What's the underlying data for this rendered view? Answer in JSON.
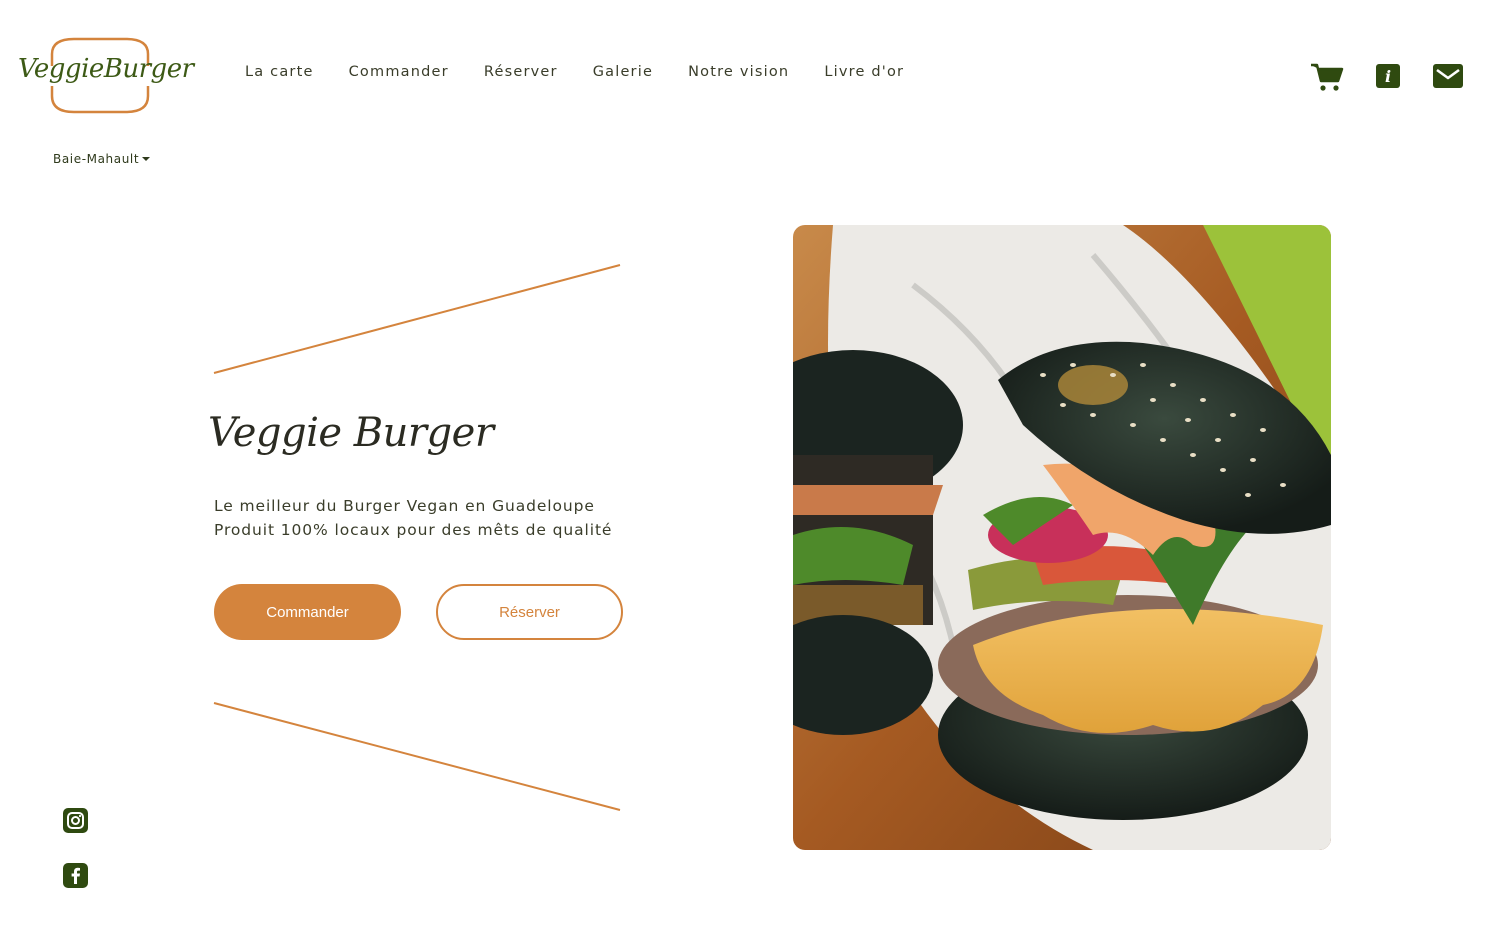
{
  "brand": {
    "logo_text": "VeggieBurger"
  },
  "nav": {
    "items": [
      "La carte",
      "Commander",
      "Réserver",
      "Galerie",
      "Notre vision",
      "Livre d'or"
    ]
  },
  "header_icons": [
    "cart-icon",
    "info-icon",
    "mail-icon"
  ],
  "location": {
    "selected": "Baie-Mahault"
  },
  "hero": {
    "title": "Veggie Burger",
    "line1": "Le meilleur du Burger Vegan en Guadeloupe",
    "line2": "Produit 100% locaux pour des mêts de qualité",
    "primary_button": "Commander",
    "secondary_button": "Réserver"
  },
  "social": [
    "instagram-icon",
    "facebook-icon"
  ],
  "colors": {
    "accent": "#d4843d",
    "brand_green": "#2f4a10",
    "text": "#3a3d2a"
  }
}
